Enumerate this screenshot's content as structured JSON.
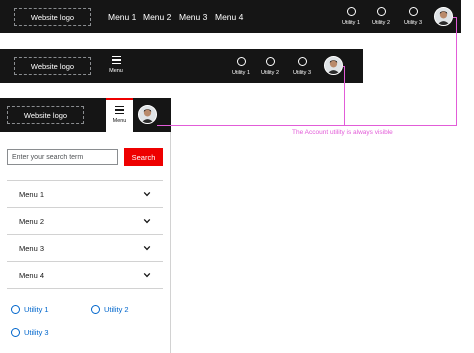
{
  "desktop_header": {
    "logo": "Website logo",
    "menu_items": [
      "Menu 1",
      "Menu 2",
      "Menu 3",
      "Menu 4"
    ],
    "utilities": [
      "Utility 1",
      "Utility 2",
      "Utility 3"
    ]
  },
  "tablet_header": {
    "logo": "Website logo",
    "menu_label": "Menu",
    "utilities": [
      "Utility 1",
      "Utility 2",
      "Utility 3"
    ]
  },
  "mobile_header": {
    "logo": "Website logo",
    "menu_label": "Menu"
  },
  "mobile_dropdown": {
    "search_placeholder": "Enter your search term",
    "search_button": "Search",
    "menu_items": [
      "Menu 1",
      "Menu 2",
      "Menu 3",
      "Menu 4"
    ],
    "utilities": [
      "Utility 1",
      "Utility 2",
      "Utility 3"
    ]
  },
  "annotation": "The Account utility is always visible",
  "colors": {
    "header_bg": "#151515",
    "accent_red": "#ee0000",
    "link_blue": "#0066cc",
    "annotation_pink": "#e25cd8"
  },
  "icons": [
    "utility-circle-icon",
    "hamburger-icon",
    "chevron-down-icon",
    "avatar"
  ]
}
